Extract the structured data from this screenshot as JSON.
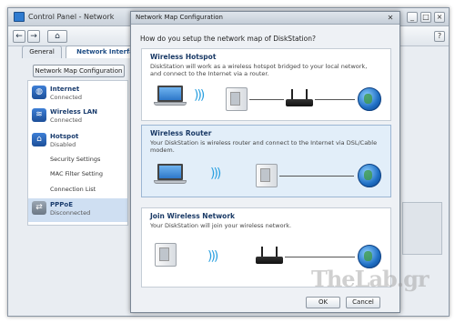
{
  "window": {
    "title": "Control Panel - Network",
    "buttons": [
      "_",
      "□",
      "×"
    ],
    "help": "?"
  },
  "toolbar": {
    "back": "←",
    "forward": "→",
    "home": "⌂"
  },
  "tabs": [
    {
      "label": "General"
    },
    {
      "label": "Network Interfa"
    }
  ],
  "map_config_button": "Network Map Configuration",
  "interfaces": [
    {
      "name": "Internet",
      "status": "Connected",
      "icon": "globe-icon"
    },
    {
      "name": "Wireless LAN",
      "status": "Connected",
      "icon": "wireless-icon"
    },
    {
      "name": "Hotspot",
      "status": "Disabled",
      "icon": "hotspot-icon"
    },
    {
      "name": "PPPoE",
      "status": "Disconnected",
      "icon": "pppoe-icon"
    }
  ],
  "hotspot_sub": [
    "Security Settings",
    "MAC Filter Setting",
    "Connection List"
  ],
  "dialog": {
    "title": "Network Map Configuration",
    "question": "How do you setup the network map of DiskStation?",
    "options": [
      {
        "title": "Wireless Hotspot",
        "description": "DiskStation will work as a wireless hotspot bridged to your local network, and connect to the Internet via a router."
      },
      {
        "title": "Wireless Router",
        "description": "Your DiskStation is wireless router and connect to the Internet via DSL/Cable modem."
      },
      {
        "title": "Join Wireless Network",
        "description": "Your DiskStation will join your wireless network."
      }
    ],
    "ok": "OK",
    "cancel": "Cancel"
  },
  "watermark": "TheLab.gr"
}
